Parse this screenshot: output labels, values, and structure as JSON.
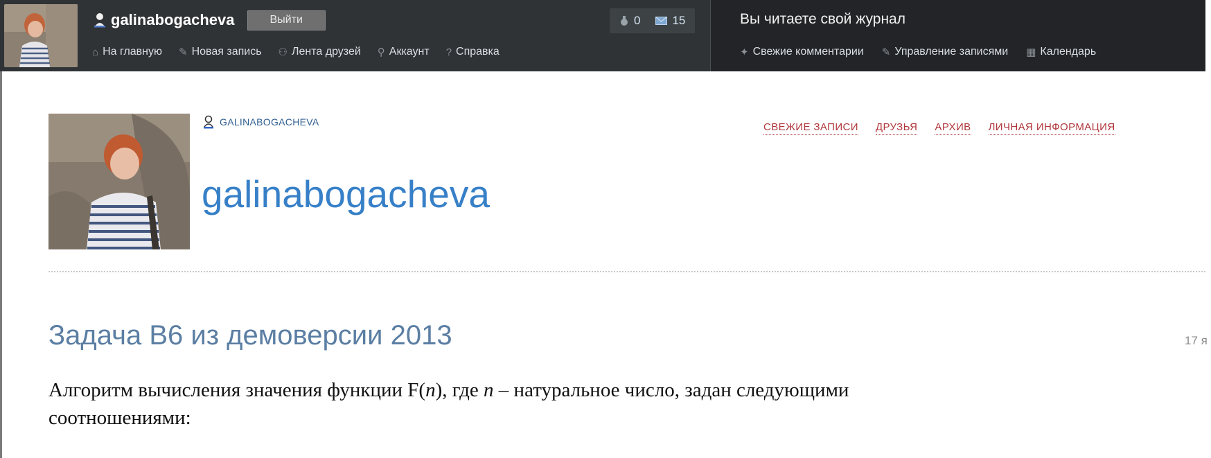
{
  "topbar": {
    "username": "galinabogacheva",
    "logout_label": "Выйти",
    "counters": [
      {
        "icon": "gift-icon",
        "value": "0"
      },
      {
        "icon": "envelope-icon",
        "value": "15"
      }
    ],
    "nav": [
      {
        "icon": "home-icon",
        "label": "На главную"
      },
      {
        "icon": "pencil-icon",
        "label": "Новая запись"
      },
      {
        "icon": "friends-icon",
        "label": "Лента друзей"
      },
      {
        "icon": "wrench-icon",
        "label": "Аккаунт"
      },
      {
        "icon": "help-icon",
        "label": "Справка"
      }
    ],
    "journal_title": "Вы читаете свой журнал",
    "journal_nav": [
      {
        "icon": "comments-icon",
        "label": "Свежие комментарии"
      },
      {
        "icon": "edit-entries-icon",
        "label": "Управление записями"
      },
      {
        "icon": "calendar-icon",
        "label": "Календарь"
      }
    ]
  },
  "header": {
    "user_small": "GALINABOGACHEVA",
    "journal_name": "galinabogacheva",
    "links": [
      "СВЕЖИЕ ЗАПИСИ",
      "ДРУЗЬЯ",
      "АРХИВ",
      "ЛИЧНАЯ ИНФОРМАЦИЯ"
    ]
  },
  "post": {
    "title": "Задача B6 из демоверсии 2013",
    "date": "17 я",
    "body_part1": "Алгоритм вычисления значения функции F(",
    "body_var1": "n",
    "body_part2": "), где ",
    "body_var2": "n",
    "body_part3": " – натуральное число, задан следующими",
    "body_line2": "соотношениями:"
  },
  "colors": {
    "topbar_bg": "#2f3336",
    "journal_pane_bg": "#222427",
    "journal_name": "#3780c8",
    "post_title": "#5b7ea3",
    "header_link": "#b0353a"
  }
}
